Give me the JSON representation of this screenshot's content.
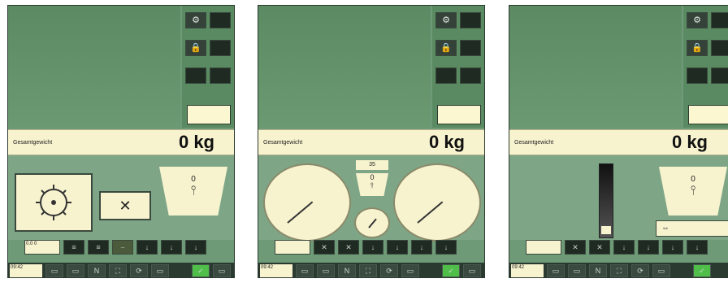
{
  "panels": [
    {
      "weight_label": "Gesamtgewicht",
      "weight_value": "0 kg",
      "tank_value": "0",
      "cross_label": "✕",
      "info_text": "0.0 0",
      "footer_time": "09:42",
      "toolbar_icons": [
        "≡",
        "≡",
        "⎯",
        "↓",
        "↓",
        "↓"
      ]
    },
    {
      "weight_label": "Gesamtgewicht",
      "weight_value": "0 kg",
      "small_tank_value": "0",
      "small_top_label": "35",
      "footer_time": "09:42",
      "toolbar_icons": [
        "✕",
        "✕",
        "↓",
        "↓",
        "↓",
        "↓"
      ]
    },
    {
      "weight_label": "Gesamtgewicht",
      "weight_value": "0 kg",
      "tank_value": "0",
      "footer_time": "09:42",
      "toolbar_icons": [
        "✕",
        "✕",
        "↓",
        "↓",
        "↓",
        "↓"
      ]
    }
  ],
  "footer_icons": [
    "▭",
    "▭",
    "N",
    "⛶",
    "⟳",
    "▭",
    "✓",
    "▭"
  ]
}
